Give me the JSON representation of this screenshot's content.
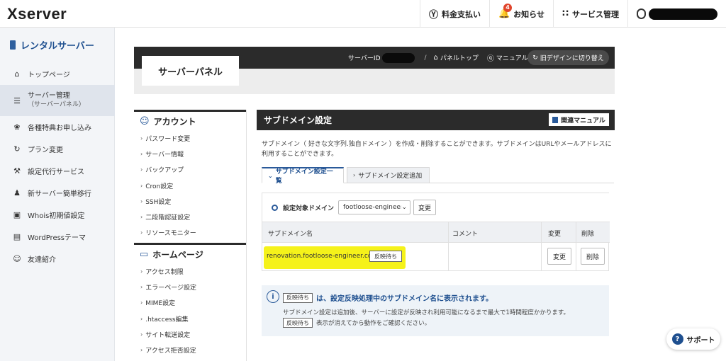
{
  "header": {
    "logo": "Xserver",
    "nav": [
      {
        "label": "料金支払い",
        "icon": "yen-icon"
      },
      {
        "label": "お知らせ",
        "icon": "bell-icon",
        "badge": "4"
      },
      {
        "label": "サービス管理",
        "icon": "grid-icon"
      }
    ]
  },
  "sidebar": {
    "heading": "レンタルサーバー",
    "items": [
      {
        "label": "トップページ",
        "icon": "home-icon"
      },
      {
        "label": "サーバー管理",
        "sub": "（サーバーパネル）",
        "icon": "server-icon"
      },
      {
        "label": "各種特典お申し込み",
        "icon": "gift-icon"
      },
      {
        "label": "プラン変更",
        "icon": "refresh-icon"
      },
      {
        "label": "設定代行サービス",
        "icon": "wrench-icon"
      },
      {
        "label": "新サーバー簡単移行",
        "icon": "migrate-icon"
      },
      {
        "label": "Whois初期値設定",
        "icon": "whois-icon"
      },
      {
        "label": "WordPressテーマ",
        "icon": "wordpress-icon"
      },
      {
        "label": "友達紹介",
        "icon": "friend-icon"
      }
    ]
  },
  "panel": {
    "title": "サーバーパネル",
    "server_label": "サーバーID",
    "top_link": "パネルトップ",
    "manual_link": "マニュアル",
    "old_design": "旧デザインに切り替え"
  },
  "menu": {
    "account_heading": "アカウント",
    "account_items": [
      "パスワード変更",
      "サーバー情報",
      "バックアップ",
      "Cron設定",
      "SSH設定",
      "二段階認証設定",
      "リソースモニター"
    ],
    "homepage_heading": "ホームページ",
    "homepage_items": [
      "アクセス制限",
      "エラーページ設定",
      "MIME設定",
      ".htaccess編集",
      "サイト転送設定",
      "アクセス拒否設定"
    ]
  },
  "content": {
    "title": "サブドメイン設定",
    "manual_btn": "関連マニュアル",
    "description": "サブドメイン（ 好きな文字列.独自ドメイン ）を作成・削除することができます。サブドメインはURLやメールアドレスに利用することができます。",
    "tab_list": "サブドメイン設定一覧",
    "tab_add": "サブドメイン設定追加",
    "domain_label": "設定対象ドメイン",
    "domain_value": "footloose-engineer.com",
    "change_label": "変更",
    "columns": [
      "サブドメイン名",
      "コメント",
      "変更",
      "削除"
    ],
    "rows": [
      {
        "name": "renovation.footloose-engineer.com",
        "status": "反映待ち",
        "comment": "",
        "edit": "変更",
        "delete": "削除"
      }
    ],
    "note_tag": "反映待ち",
    "note_title": "は、設定反映処理中のサブドメイン名に表示されます。",
    "note_line1": "サブドメイン設定は追加後、サーバーに設定が反映され利用可能になるまで最大で1時間程度かかります。",
    "note_line2": "表示が消えてから動作をご確認ください。"
  },
  "support": {
    "label": "サポート"
  }
}
